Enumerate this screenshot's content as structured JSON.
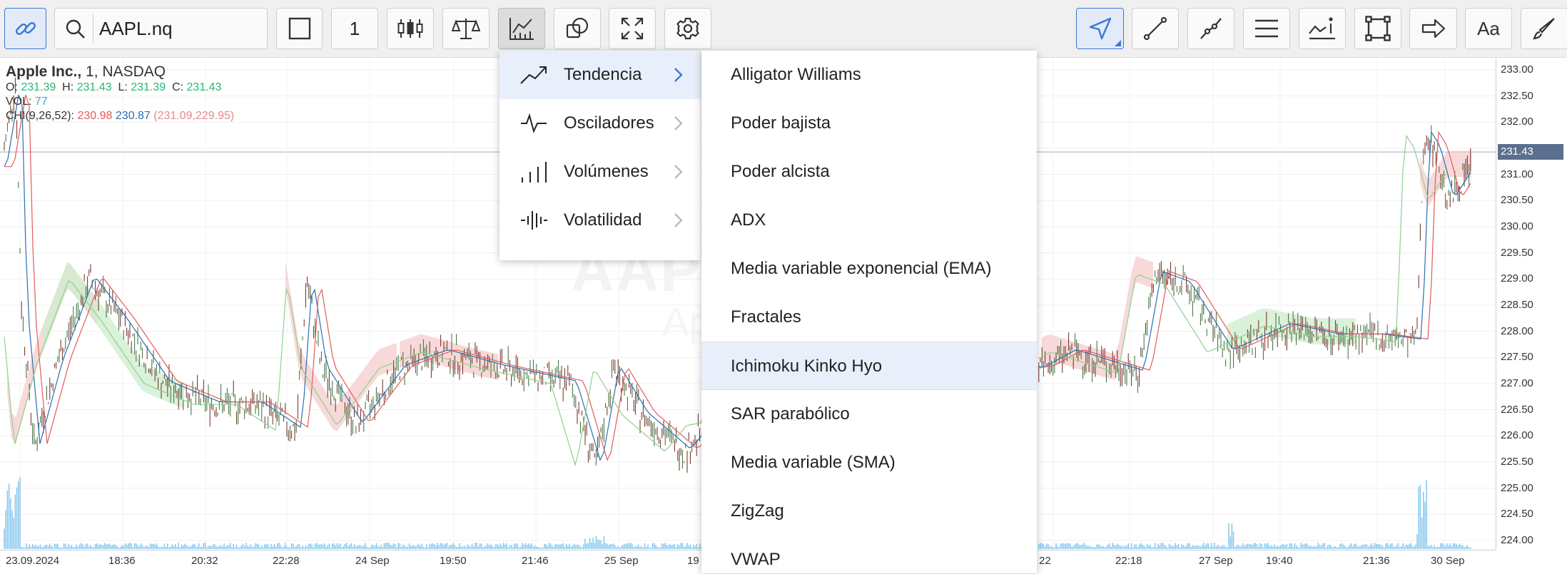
{
  "toolbar": {
    "symbol_value": "AAPL.nq",
    "interval": "1",
    "text_tool_label": "Aa"
  },
  "legend": {
    "name": "Apple Inc.,",
    "interval": "1,",
    "exchange": "NASDAQ",
    "o_label": "O:",
    "o_value": "231.39",
    "h_label": "H:",
    "h_value": "231.43",
    "l_label": "L:",
    "l_value": "231.39",
    "c_label": "C:",
    "c_value": "231.43",
    "vol_label": "VOL:",
    "vol_value": "77",
    "chi_label": "CHI(9,26,52):",
    "chi_v1": "230.98",
    "chi_v2": "230.87",
    "chi_v3": "(231.09,229.95)"
  },
  "watermark": {
    "symbol": "AAPL",
    "name": "Apple Inc."
  },
  "price_axis": [
    "233.00",
    "232.50",
    "232.00",
    "231.50",
    "231.00",
    "230.50",
    "230.00",
    "229.50",
    "229.00",
    "228.50",
    "228.00",
    "227.50",
    "227.00",
    "226.50",
    "226.00",
    "225.50",
    "225.00",
    "224.50",
    "224.00"
  ],
  "last_price": "231.43",
  "time_axis": [
    "23.09.2024",
    "18:36",
    "20:32",
    "22:28",
    "24 Sep",
    "19:50",
    "21:46",
    "25 Sep",
    "19",
    "22",
    "22:18",
    "27 Sep",
    "19:40",
    "21:36",
    "30 Sep"
  ],
  "indicator_menu": {
    "categories": [
      {
        "label": "Tendencia",
        "icon": "trend-icon"
      },
      {
        "label": "Osciladores",
        "icon": "oscillator-icon"
      },
      {
        "label": "Volúmenes",
        "icon": "volume-icon"
      },
      {
        "label": "Volatilidad",
        "icon": "volatility-icon"
      }
    ],
    "items": [
      "Alligator Williams",
      "Poder bajista",
      "Poder alcista",
      "ADX",
      "Media variable exponencial (EMA)",
      "Fractales",
      "Ichimoku Kinko Hyo",
      "SAR parabólico",
      "Media variable (SMA)",
      "ZigZag",
      "VWAP"
    ],
    "selected_item": "Ichimoku Kinko Hyo",
    "selected_category": "Tendencia"
  },
  "colors": {
    "accent": "#3b78d8",
    "candle_up": "#2bb673",
    "candle_down": "#e35b5b",
    "kumo_bull": "#cdeccd",
    "kumo_bear": "#f6cccc",
    "volume": "#7dc3ec"
  }
}
